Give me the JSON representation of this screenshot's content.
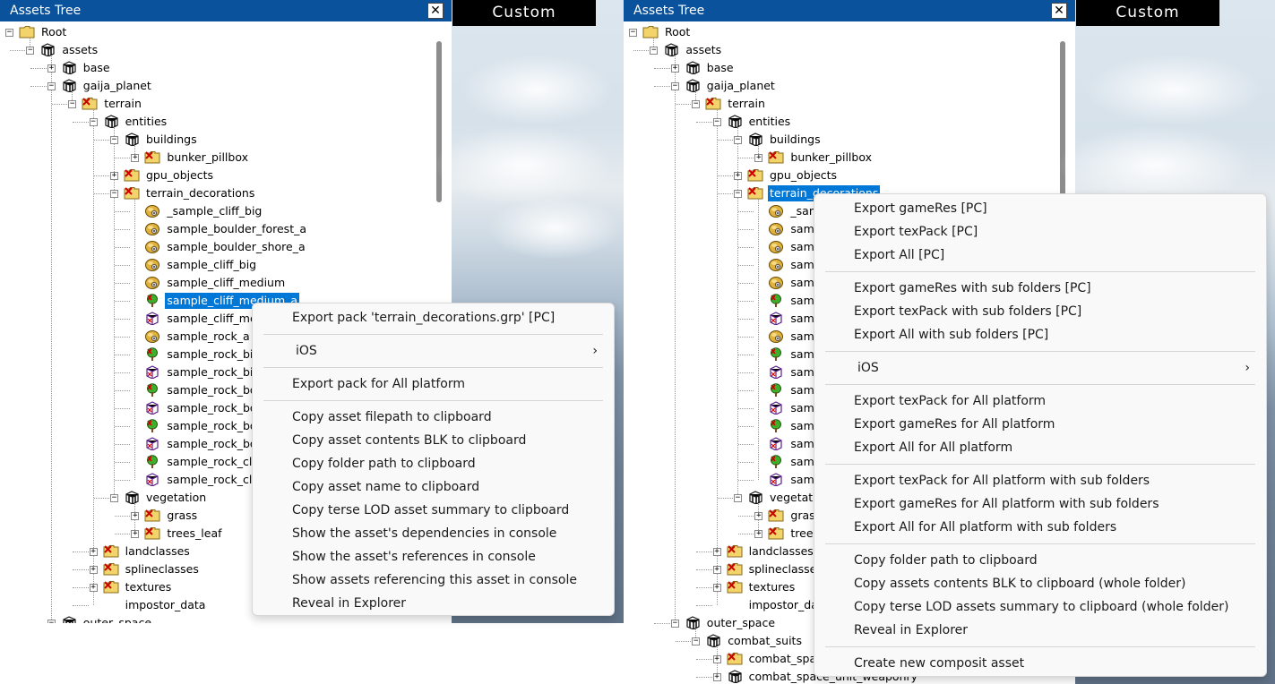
{
  "left": {
    "title": "Assets Tree",
    "close": "✕",
    "custom": "Custom",
    "rows": [
      {
        "label": "Root",
        "depth": 0,
        "exp": "minus",
        "icon": "folder"
      },
      {
        "label": "assets",
        "depth": 1,
        "exp": "minus",
        "icon": "pack"
      },
      {
        "label": "base",
        "depth": 2,
        "exp": "plus",
        "icon": "pack"
      },
      {
        "label": "gaija_planet",
        "depth": 2,
        "exp": "minus",
        "icon": "pack"
      },
      {
        "label": "terrain",
        "depth": 3,
        "exp": "minus",
        "icon": "xfolder"
      },
      {
        "label": "entities",
        "depth": 4,
        "exp": "minus",
        "icon": "pack"
      },
      {
        "label": "buildings",
        "depth": 5,
        "exp": "minus",
        "icon": "pack"
      },
      {
        "label": "bunker_pillbox",
        "depth": 6,
        "exp": "plus",
        "icon": "xfolder"
      },
      {
        "label": "gpu_objects",
        "depth": 5,
        "exp": "plus",
        "icon": "xfolder"
      },
      {
        "label": "terrain_decorations",
        "depth": 5,
        "exp": "minus",
        "icon": "xfolder"
      },
      {
        "label": "_sample_cliff_big",
        "depth": 6,
        "exp": "",
        "icon": "rock"
      },
      {
        "label": "sample_boulder_forest_a",
        "depth": 6,
        "exp": "",
        "icon": "rock"
      },
      {
        "label": "sample_boulder_shore_a",
        "depth": 6,
        "exp": "",
        "icon": "rock"
      },
      {
        "label": "sample_cliff_big",
        "depth": 6,
        "exp": "",
        "icon": "rock"
      },
      {
        "label": "sample_cliff_medium",
        "depth": 6,
        "exp": "",
        "icon": "rock"
      },
      {
        "label": "sample_cliff_medium_a",
        "depth": 6,
        "exp": "",
        "icon": "tree",
        "selected": true
      },
      {
        "label": "sample_cliff_me",
        "depth": 6,
        "exp": "",
        "icon": "cube"
      },
      {
        "label": "sample_rock_a",
        "depth": 6,
        "exp": "",
        "icon": "rock"
      },
      {
        "label": "sample_rock_big",
        "depth": 6,
        "exp": "",
        "icon": "tree"
      },
      {
        "label": "sample_rock_big",
        "depth": 6,
        "exp": "",
        "icon": "cube"
      },
      {
        "label": "sample_rock_bo",
        "depth": 6,
        "exp": "",
        "icon": "tree"
      },
      {
        "label": "sample_rock_bo",
        "depth": 6,
        "exp": "",
        "icon": "cube"
      },
      {
        "label": "sample_rock_bo",
        "depth": 6,
        "exp": "",
        "icon": "tree"
      },
      {
        "label": "sample_rock_bo",
        "depth": 6,
        "exp": "",
        "icon": "cube"
      },
      {
        "label": "sample_rock_clif",
        "depth": 6,
        "exp": "",
        "icon": "tree"
      },
      {
        "label": "sample_rock_clif",
        "depth": 6,
        "exp": "",
        "icon": "cube"
      },
      {
        "label": "vegetation",
        "depth": 5,
        "exp": "minus",
        "icon": "pack"
      },
      {
        "label": "grass",
        "depth": 6,
        "exp": "plus",
        "icon": "xfolder"
      },
      {
        "label": "trees_leaf",
        "depth": 6,
        "exp": "plus",
        "icon": "xfolder"
      },
      {
        "label": "landclasses",
        "depth": 4,
        "exp": "plus",
        "icon": "xfolder"
      },
      {
        "label": "splineclasses",
        "depth": 4,
        "exp": "plus",
        "icon": "xfolder"
      },
      {
        "label": "textures",
        "depth": 4,
        "exp": "plus",
        "icon": "xfolder"
      },
      {
        "label": "impostor_data",
        "depth": 4,
        "exp": "",
        "icon": "none"
      },
      {
        "label": "outer_space",
        "depth": 2,
        "exp": "minus",
        "icon": "pack"
      }
    ],
    "menu": [
      {
        "label": "Export pack 'terrain_decorations.grp' [PC]"
      },
      {
        "sep": true
      },
      {
        "label": "iOS",
        "submenu": true
      },
      {
        "sep": true
      },
      {
        "label": "Export pack for All platform"
      },
      {
        "sep": true
      },
      {
        "label": "Copy asset filepath to clipboard"
      },
      {
        "label": "Copy asset contents BLK to clipboard"
      },
      {
        "label": "Copy folder path to clipboard"
      },
      {
        "label": "Copy asset name to clipboard"
      },
      {
        "label": "Copy terse LOD asset summary to clipboard"
      },
      {
        "label": "Show the asset's dependencies in console"
      },
      {
        "label": "Show the asset's references in console"
      },
      {
        "label": "Show assets referencing this asset in console"
      },
      {
        "label": "Reveal in Explorer"
      }
    ]
  },
  "right": {
    "title": "Assets Tree",
    "close": "✕",
    "custom": "Custom",
    "rows": [
      {
        "label": "Root",
        "depth": 0,
        "exp": "minus",
        "icon": "folder"
      },
      {
        "label": "assets",
        "depth": 1,
        "exp": "minus",
        "icon": "pack"
      },
      {
        "label": "base",
        "depth": 2,
        "exp": "plus",
        "icon": "pack"
      },
      {
        "label": "gaija_planet",
        "depth": 2,
        "exp": "minus",
        "icon": "pack"
      },
      {
        "label": "terrain",
        "depth": 3,
        "exp": "minus",
        "icon": "xfolder"
      },
      {
        "label": "entities",
        "depth": 4,
        "exp": "minus",
        "icon": "pack"
      },
      {
        "label": "buildings",
        "depth": 5,
        "exp": "minus",
        "icon": "pack"
      },
      {
        "label": "bunker_pillbox",
        "depth": 6,
        "exp": "plus",
        "icon": "xfolder"
      },
      {
        "label": "gpu_objects",
        "depth": 5,
        "exp": "plus",
        "icon": "xfolder"
      },
      {
        "label": "terrain_decorations",
        "depth": 5,
        "exp": "minus",
        "icon": "xfolder",
        "selected": true
      },
      {
        "label": "_san",
        "depth": 6,
        "exp": "",
        "icon": "rock"
      },
      {
        "label": "samp",
        "depth": 6,
        "exp": "",
        "icon": "rock"
      },
      {
        "label": "samp",
        "depth": 6,
        "exp": "",
        "icon": "rock"
      },
      {
        "label": "samp",
        "depth": 6,
        "exp": "",
        "icon": "rock"
      },
      {
        "label": "samp",
        "depth": 6,
        "exp": "",
        "icon": "rock"
      },
      {
        "label": "samp",
        "depth": 6,
        "exp": "",
        "icon": "tree"
      },
      {
        "label": "samp",
        "depth": 6,
        "exp": "",
        "icon": "cube"
      },
      {
        "label": "samp",
        "depth": 6,
        "exp": "",
        "icon": "rock"
      },
      {
        "label": "samp",
        "depth": 6,
        "exp": "",
        "icon": "tree"
      },
      {
        "label": "samp",
        "depth": 6,
        "exp": "",
        "icon": "cube"
      },
      {
        "label": "samp",
        "depth": 6,
        "exp": "",
        "icon": "tree"
      },
      {
        "label": "samp",
        "depth": 6,
        "exp": "",
        "icon": "cube"
      },
      {
        "label": "samp",
        "depth": 6,
        "exp": "",
        "icon": "tree"
      },
      {
        "label": "samp",
        "depth": 6,
        "exp": "",
        "icon": "cube"
      },
      {
        "label": "samp",
        "depth": 6,
        "exp": "",
        "icon": "tree"
      },
      {
        "label": "samp",
        "depth": 6,
        "exp": "",
        "icon": "cube"
      },
      {
        "label": "vegetatio",
        "depth": 5,
        "exp": "minus",
        "icon": "pack"
      },
      {
        "label": "grass",
        "depth": 6,
        "exp": "plus",
        "icon": "xfolder"
      },
      {
        "label": "trees",
        "depth": 6,
        "exp": "plus",
        "icon": "xfolder"
      },
      {
        "label": "landclasses",
        "depth": 4,
        "exp": "plus",
        "icon": "xfolder"
      },
      {
        "label": "splineclasses",
        "depth": 4,
        "exp": "plus",
        "icon": "xfolder"
      },
      {
        "label": "textures",
        "depth": 4,
        "exp": "plus",
        "icon": "xfolder"
      },
      {
        "label": "impostor_data",
        "depth": 4,
        "exp": "",
        "icon": "none"
      },
      {
        "label": "outer_space",
        "depth": 2,
        "exp": "minus",
        "icon": "pack"
      },
      {
        "label": "combat_suits",
        "depth": 3,
        "exp": "minus",
        "icon": "pack"
      },
      {
        "label": "combat_spac",
        "depth": 4,
        "exp": "plus",
        "icon": "xfolder"
      },
      {
        "label": "combat_space_unit_weaponry",
        "depth": 4,
        "exp": "plus",
        "icon": "pack"
      }
    ],
    "menu": [
      {
        "label": "Export gameRes [PC]"
      },
      {
        "label": "Export texPack [PC]"
      },
      {
        "label": "Export All [PC]"
      },
      {
        "sep": true
      },
      {
        "label": "Export gameRes with sub folders [PC]"
      },
      {
        "label": "Export texPack with sub folders [PC]"
      },
      {
        "label": "Export All with sub folders [PC]"
      },
      {
        "sep": true
      },
      {
        "label": "iOS",
        "submenu": true
      },
      {
        "sep": true
      },
      {
        "label": "Export texPack for All platform"
      },
      {
        "label": "Export gameRes for All platform"
      },
      {
        "label": "Export All for All platform"
      },
      {
        "sep": true
      },
      {
        "label": "Export texPack for All platform with sub folders"
      },
      {
        "label": "Export gameRes for All platform with sub folders"
      },
      {
        "label": "Export All for All platform with sub folders"
      },
      {
        "sep": true
      },
      {
        "label": "Copy folder path to clipboard"
      },
      {
        "label": "Copy assets contents BLK to clipboard (whole folder)"
      },
      {
        "label": "Copy terse LOD assets summary to clipboard (whole folder)"
      },
      {
        "label": "Reveal in Explorer"
      },
      {
        "sep": true
      },
      {
        "label": "Create new composit asset"
      }
    ]
  },
  "colors": {
    "title_bar": "#0a539c",
    "selection": "#0078d7",
    "menu_bg": "#f9f9f9"
  }
}
